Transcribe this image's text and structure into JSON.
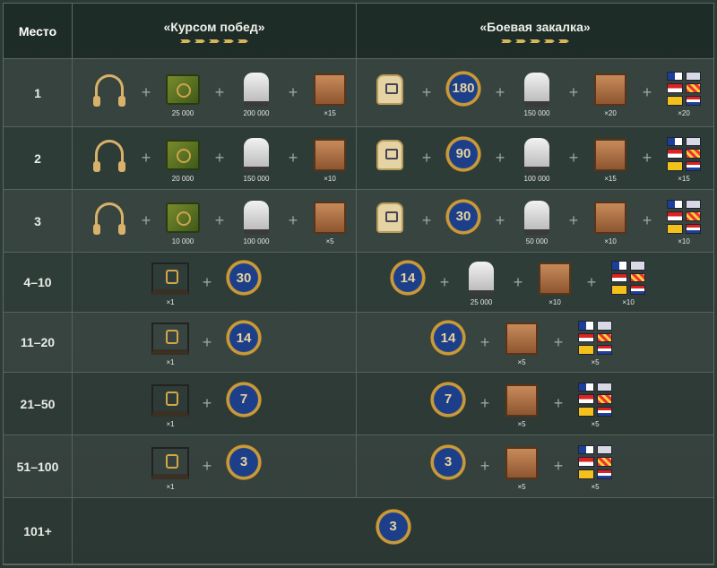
{
  "header": {
    "place_label": "Место",
    "col1_title": "«Курсом побед»",
    "col2_title": "«Боевая закалка»"
  },
  "rows": [
    {
      "place": "1",
      "a": [
        {
          "icon": "headset-icon",
          "cap": ""
        },
        {
          "icon": "credits-safe-icon",
          "cap": "25 000"
        },
        {
          "icon": "coal-sack-icon",
          "cap": "200 000"
        },
        {
          "icon": "supply-crate-icon",
          "cap": "×15"
        }
      ],
      "b": [
        {
          "icon": "backpack-icon",
          "cap": ""
        },
        {
          "icon": "medal-icon",
          "label": "180",
          "cap": ""
        },
        {
          "icon": "coal-sack-icon",
          "cap": "150 000"
        },
        {
          "icon": "supply-crate-icon",
          "cap": "×20"
        },
        {
          "icon": "signal-flags-icon",
          "cap": "×20"
        }
      ]
    },
    {
      "place": "2",
      "a": [
        {
          "icon": "headset-icon",
          "cap": ""
        },
        {
          "icon": "credits-safe-icon",
          "cap": "20 000"
        },
        {
          "icon": "coal-sack-icon",
          "cap": "150 000"
        },
        {
          "icon": "supply-crate-icon",
          "cap": "×10"
        }
      ],
      "b": [
        {
          "icon": "backpack-icon",
          "cap": ""
        },
        {
          "icon": "medal-icon",
          "label": "90",
          "cap": ""
        },
        {
          "icon": "coal-sack-icon",
          "cap": "100 000"
        },
        {
          "icon": "supply-crate-icon",
          "cap": "×15"
        },
        {
          "icon": "signal-flags-icon",
          "cap": "×15"
        }
      ]
    },
    {
      "place": "3",
      "a": [
        {
          "icon": "headset-icon",
          "cap": ""
        },
        {
          "icon": "credits-safe-icon",
          "cap": "10 000"
        },
        {
          "icon": "coal-sack-icon",
          "cap": "100 000"
        },
        {
          "icon": "supply-crate-icon",
          "cap": "×5"
        }
      ],
      "b": [
        {
          "icon": "backpack-icon",
          "cap": ""
        },
        {
          "icon": "medal-icon",
          "label": "30",
          "cap": ""
        },
        {
          "icon": "coal-sack-icon",
          "cap": "50 000"
        },
        {
          "icon": "supply-crate-icon",
          "cap": "×10"
        },
        {
          "icon": "signal-flags-icon",
          "cap": "×10"
        }
      ]
    },
    {
      "place": "4–10",
      "a": [
        {
          "icon": "container-icon",
          "cap": "×1"
        },
        {
          "icon": "medal-icon",
          "label": "30",
          "cap": ""
        }
      ],
      "b": [
        {
          "icon": "medal-icon",
          "label": "14",
          "cap": ""
        },
        {
          "icon": "coal-sack-icon",
          "cap": "25 000"
        },
        {
          "icon": "supply-crate-icon",
          "cap": "×10"
        },
        {
          "icon": "signal-flags-icon",
          "cap": "×10"
        }
      ]
    },
    {
      "place": "11–20",
      "a": [
        {
          "icon": "container-icon",
          "cap": "×1"
        },
        {
          "icon": "medal-icon",
          "label": "14",
          "cap": ""
        }
      ],
      "b": [
        {
          "icon": "medal-icon",
          "label": "14",
          "cap": ""
        },
        {
          "icon": "supply-crate-icon",
          "cap": "×5"
        },
        {
          "icon": "signal-flags-icon",
          "cap": "×5"
        }
      ]
    },
    {
      "place": "21–50",
      "a": [
        {
          "icon": "container-icon",
          "cap": "×1"
        },
        {
          "icon": "medal-icon",
          "label": "7",
          "cap": ""
        }
      ],
      "b": [
        {
          "icon": "medal-icon",
          "label": "7",
          "cap": ""
        },
        {
          "icon": "supply-crate-icon",
          "cap": "×5"
        },
        {
          "icon": "signal-flags-icon",
          "cap": "×5"
        }
      ]
    },
    {
      "place": "51–100",
      "a": [
        {
          "icon": "container-icon",
          "cap": "×1"
        },
        {
          "icon": "medal-icon",
          "label": "3",
          "cap": ""
        }
      ],
      "b": [
        {
          "icon": "medal-icon",
          "label": "3",
          "cap": ""
        },
        {
          "icon": "supply-crate-icon",
          "cap": "×5"
        },
        {
          "icon": "signal-flags-icon",
          "cap": "×5"
        }
      ]
    },
    {
      "place": "101+",
      "a": [],
      "b": [],
      "merged": [
        {
          "icon": "medal-icon",
          "label": "3",
          "cap": ""
        }
      ]
    }
  ],
  "colors": {
    "accent": "#d9b45a",
    "background": "#2f3d38",
    "grid": "#56635c"
  }
}
